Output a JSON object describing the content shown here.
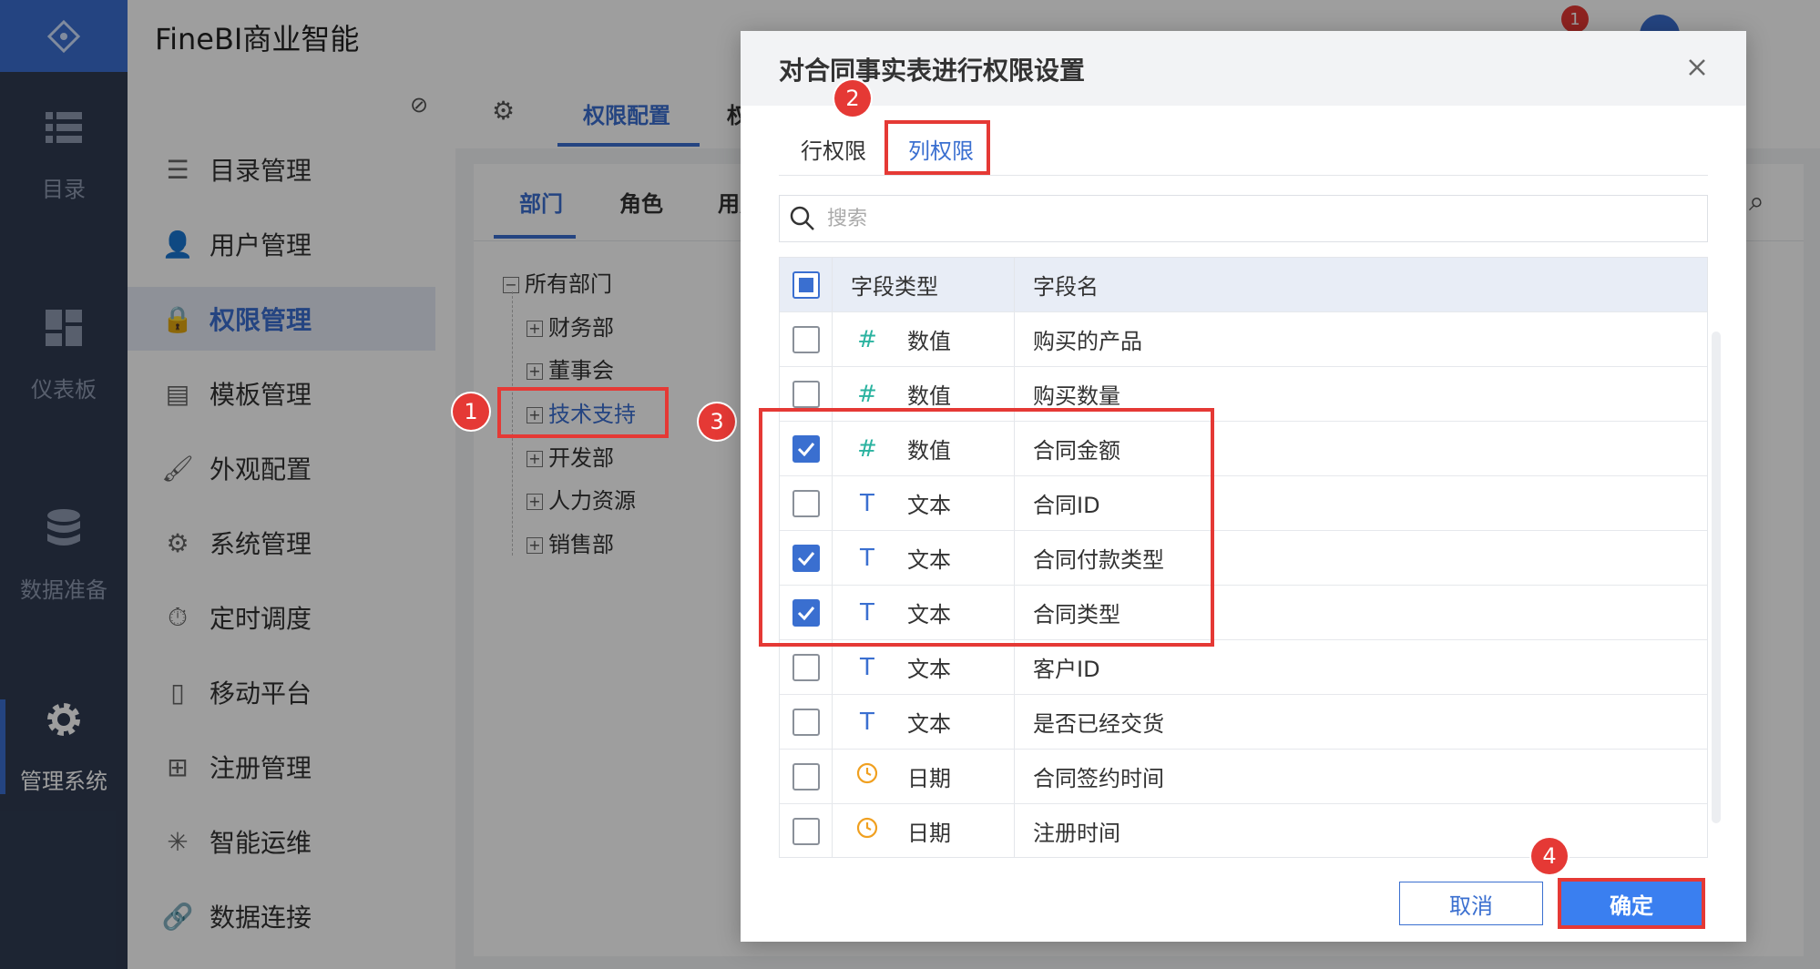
{
  "app": {
    "title": "FineBI商业智能"
  },
  "rail": [
    {
      "label": "目录",
      "icon": "list-icon"
    },
    {
      "label": "仪表板",
      "icon": "dashboard-icon"
    },
    {
      "label": "数据准备",
      "icon": "database-icon"
    },
    {
      "label": "管理系统",
      "icon": "gear-icon",
      "active": true
    }
  ],
  "header": {
    "notification_count": "1"
  },
  "menu": [
    {
      "label": "目录管理",
      "icon": "catalog-icon"
    },
    {
      "label": "用户管理",
      "icon": "user-icon"
    },
    {
      "label": "权限管理",
      "icon": "lock-icon",
      "active": true
    },
    {
      "label": "模板管理",
      "icon": "template-icon"
    },
    {
      "label": "外观配置",
      "icon": "brush-icon"
    },
    {
      "label": "系统管理",
      "icon": "gear-icon"
    },
    {
      "label": "定时调度",
      "icon": "timer-icon"
    },
    {
      "label": "移动平台",
      "icon": "mobile-icon"
    },
    {
      "label": "注册管理",
      "icon": "register-icon"
    },
    {
      "label": "智能运维",
      "icon": "ops-icon"
    },
    {
      "label": "数据连接",
      "icon": "link-icon"
    }
  ],
  "content": {
    "top_tab": "权限配置",
    "top_tab_partial": "权",
    "sub_tabs": [
      "部门",
      "角色",
      "用户"
    ],
    "tree_root": "所有部门",
    "tree": [
      "财务部",
      "董事会",
      "技术支持",
      "开发部",
      "人力资源",
      "销售部"
    ]
  },
  "dialog": {
    "title": "对合同事实表进行权限设置",
    "tabs": [
      "行权限",
      "列权限"
    ],
    "active_tab": "列权限",
    "search_placeholder": "搜索",
    "columns": [
      "字段类型",
      "字段名"
    ],
    "rows": [
      {
        "checked": false,
        "type_icon": "#",
        "type": "数值",
        "name": "购买的产品"
      },
      {
        "checked": false,
        "type_icon": "#",
        "type": "数值",
        "name": "购买数量"
      },
      {
        "checked": true,
        "type_icon": "#",
        "type": "数值",
        "name": "合同金额"
      },
      {
        "checked": false,
        "type_icon": "T",
        "type": "文本",
        "name": "合同ID"
      },
      {
        "checked": true,
        "type_icon": "T",
        "type": "文本",
        "name": "合同付款类型"
      },
      {
        "checked": true,
        "type_icon": "T",
        "type": "文本",
        "name": "合同类型"
      },
      {
        "checked": false,
        "type_icon": "T",
        "type": "文本",
        "name": "客户ID"
      },
      {
        "checked": false,
        "type_icon": "T",
        "type": "文本",
        "name": "是否已经交货"
      },
      {
        "checked": false,
        "type_icon": "clock",
        "type": "日期",
        "name": "合同签约时间"
      },
      {
        "checked": false,
        "type_icon": "clock",
        "type": "日期",
        "name": "注册时间"
      }
    ],
    "cancel_label": "取消",
    "ok_label": "确定"
  },
  "annotations": [
    "1",
    "2",
    "3",
    "4"
  ],
  "colors": {
    "accent": "#3a6fd0",
    "annotation": "#e53935",
    "number_icon": "#2bb3a0",
    "date_icon": "#f0a020"
  }
}
